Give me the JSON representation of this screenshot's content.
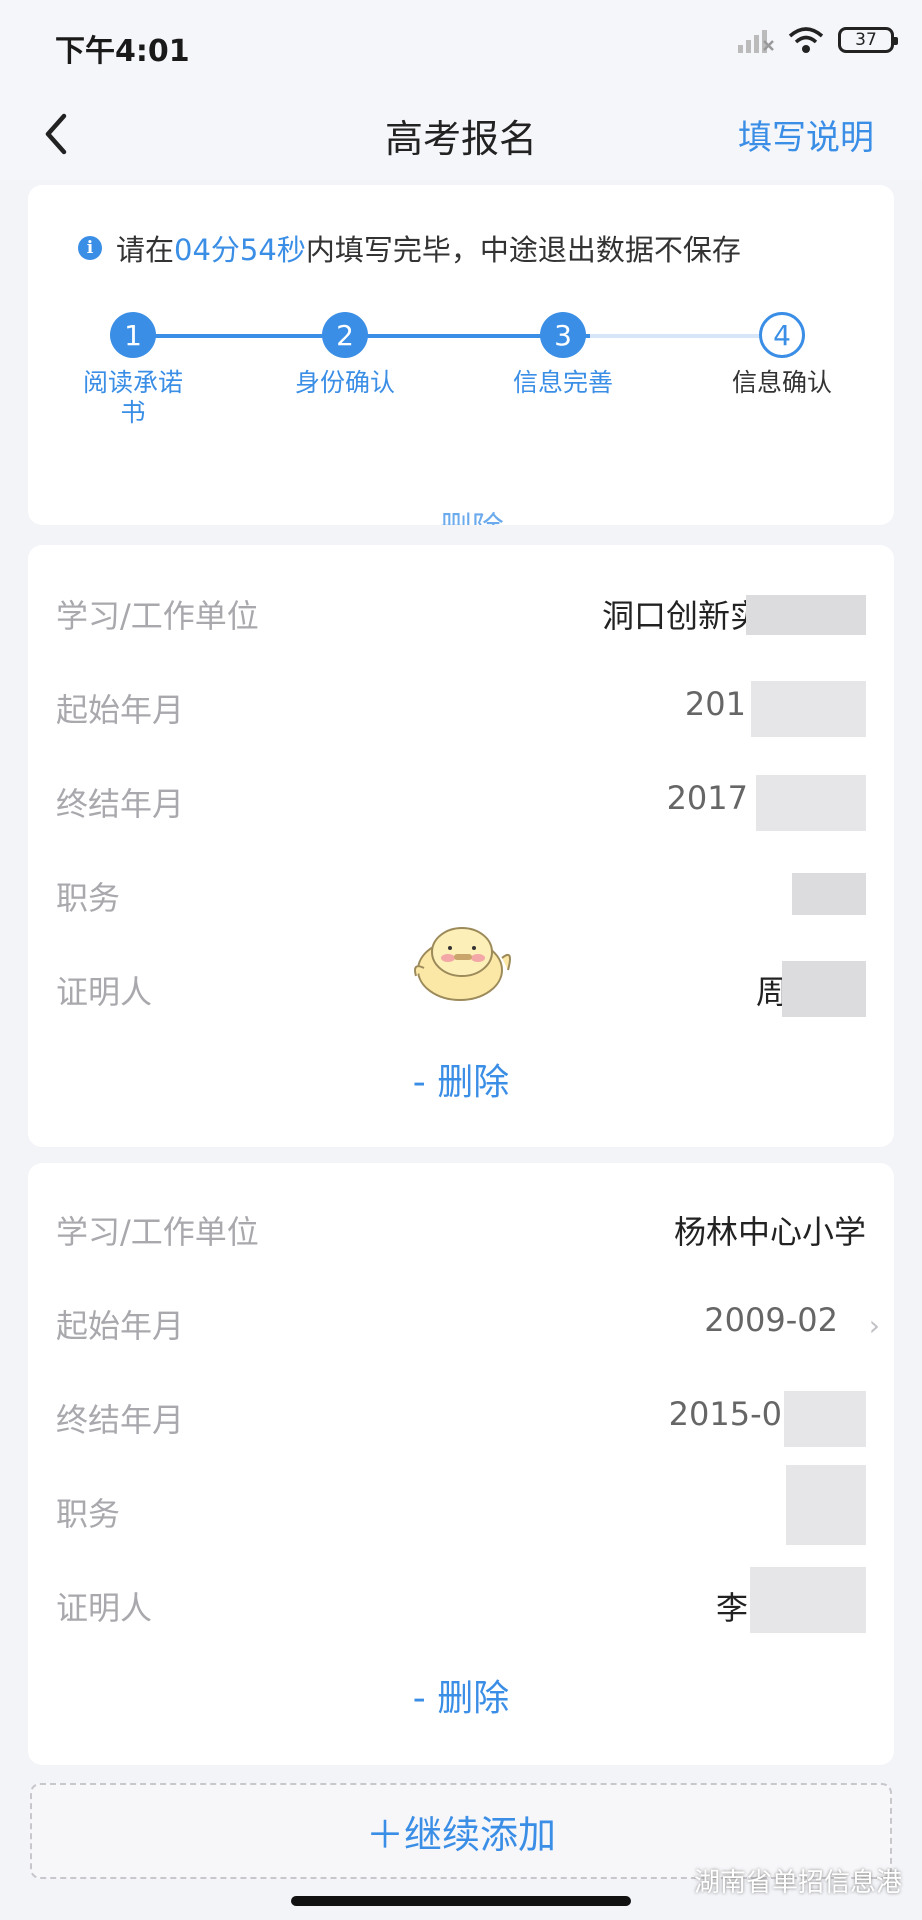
{
  "status": {
    "time": "下午4:01",
    "battery": "37"
  },
  "nav": {
    "title": "高考报名",
    "help": "填写说明"
  },
  "tip": {
    "prefix": "请在",
    "countdown": "04分54秒",
    "suffix": "内填写完毕，中途退出数据不保存"
  },
  "steps": [
    {
      "number": "1",
      "label": "阅读承诺书",
      "state": "done"
    },
    {
      "number": "2",
      "label": "身份确认",
      "state": "done"
    },
    {
      "number": "3",
      "label": "信息完善",
      "state": "current"
    },
    {
      "number": "4",
      "label": "信息确认",
      "state": "todo"
    }
  ],
  "labels": {
    "unit": "学习/工作单位",
    "start": "起始年月",
    "end": "终结年月",
    "position": "职务",
    "witness": "证明人"
  },
  "records": [
    {
      "unit": "洞口创新实",
      "start": "201",
      "end": "2017",
      "position": "",
      "witness": "周"
    },
    {
      "unit": "杨林中心小学",
      "start": "2009-02",
      "end": "2015-0",
      "position": "",
      "witness": "李"
    }
  ],
  "delete_label": "- 删除",
  "add_label": "＋继续添加",
  "watermark": "湖南省单招信息港",
  "colors": {
    "accent": "#3a8ee6",
    "background": "#f3f4f8",
    "card": "#ffffff",
    "label": "#a8a8ad"
  }
}
